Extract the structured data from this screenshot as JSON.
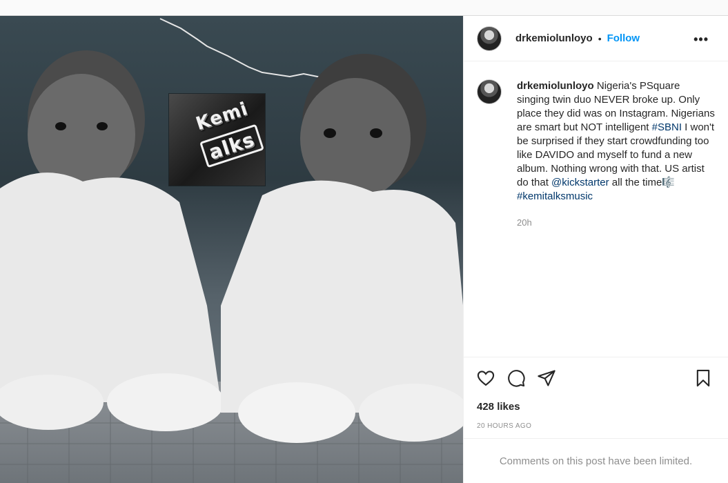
{
  "post": {
    "username": "drkemiolunloyo",
    "follow_label": "Follow",
    "separator": "•",
    "more_label": "•••",
    "caption": {
      "username": "drkemiolunloyo",
      "text_1": " Nigeria's PSquare singing twin duo NEVER broke up. Only place they did was on Instagram. Nigerians are smart but NOT intelligent ",
      "hashtag_1": "#SBNI",
      "text_2": " I won't be surprised if they start crowdfunding too like DAVIDO and myself to fund a new album. Nothing wrong with that. US artist do that ",
      "mention": "@kickstarter",
      "text_3": " all the time🎼",
      "hashtag_2": "#kemitalksmusic",
      "time": "20h"
    },
    "likes": "428 likes",
    "ago": "20 HOURS AGO",
    "comments_limited": "Comments on this post have been limited."
  },
  "watermark": {
    "line1": "Kemi",
    "line2": "alks"
  },
  "icons": [
    "heart-icon",
    "comment-icon",
    "share-icon",
    "bookmark-icon",
    "more-icon"
  ],
  "colors": {
    "follow": "#0095f6",
    "link": "#00376b",
    "muted": "#8e8e8e"
  }
}
